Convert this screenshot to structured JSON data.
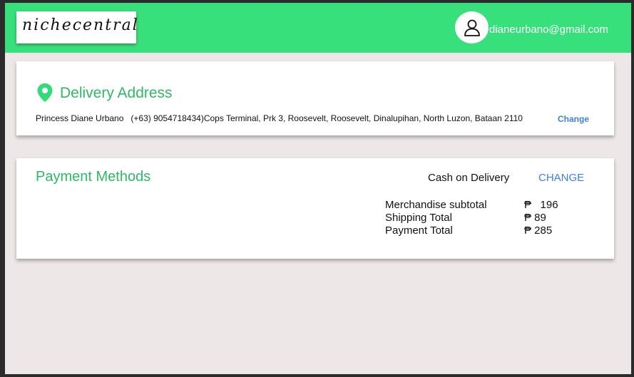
{
  "header": {
    "logo_text": "nichecentral",
    "user_email": "dianeurbano@gmail.com",
    "accent_color": "#38e07b"
  },
  "delivery": {
    "title": "Delivery Address",
    "name": "Princess Diane Urbano",
    "details": "(+63) 9054718434)Cops Terminal, Prk 3, Roosevelt, Roosevelt, Dinalupihan, North Luzon, Bataan 2110",
    "change_label": "Change",
    "icon": "location-pin-icon"
  },
  "payment": {
    "title": "Payment Methods",
    "method": "Cash on Delivery",
    "change_label": "CHANGE",
    "summary": [
      {
        "label": "Merchandise subtotal",
        "value": "₱   196"
      },
      {
        "label": "Shipping Total",
        "value": "₱ 89"
      },
      {
        "label": "Payment Total",
        "value": "₱ 285"
      }
    ]
  }
}
